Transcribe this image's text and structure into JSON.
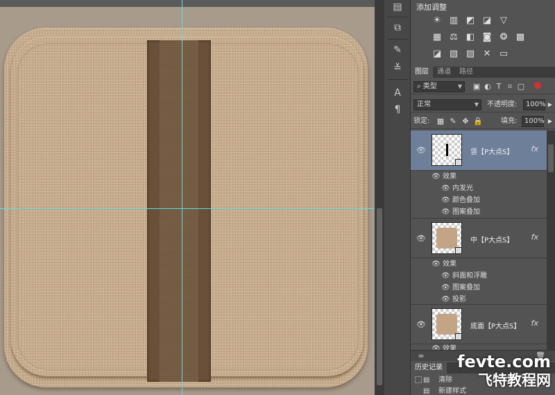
{
  "adjustments": {
    "title": "添加调整",
    "row1": [
      "brightness-contrast-icon",
      "levels-icon",
      "curves-icon",
      "exposure-icon",
      "vibrance-icon"
    ],
    "row2": [
      "hue-saturation-icon",
      "color-balance-icon",
      "black-white-icon",
      "photo-filter-icon",
      "channel-mixer-icon",
      "color-lookup-icon"
    ],
    "row3": [
      "invert-icon",
      "posterize-icon",
      "threshold-icon",
      "selective-color-icon",
      "gradient-map-icon"
    ]
  },
  "tabs": {
    "layers": "图层",
    "channels": "通道",
    "paths": "路径"
  },
  "filter": {
    "kind": "类型"
  },
  "blend": {
    "mode": "正常",
    "opacity_label": "不透明度:",
    "opacity_value": "100%"
  },
  "lock": {
    "label": "锁定:",
    "fill_label": "填充:",
    "fill_value": "100%"
  },
  "layers": [
    {
      "name": "竖【P大点S】",
      "selected": true,
      "effects_label": "效果",
      "effects": [
        "内发光",
        "颜色叠加",
        "图案叠加"
      ]
    },
    {
      "name": "中【P大点S】",
      "selected": false,
      "effects_label": "效果",
      "effects": [
        "斜面和浮雕",
        "图案叠加",
        "投影"
      ]
    },
    {
      "name": "底面【P大点S】",
      "selected": false,
      "effects_label": "效果",
      "effects": []
    }
  ],
  "fx_label": "fx",
  "history": {
    "tab": "历史记录",
    "items": [
      "清除",
      "新建样式"
    ]
  },
  "watermark": {
    "line1": "fevte.com",
    "line2": "飞特教程网"
  },
  "colors": {
    "guide": "#4fe6e6",
    "icon_base": "#c5a888",
    "stripe": "#6b5039",
    "selected_layer": "#6e7f99"
  }
}
